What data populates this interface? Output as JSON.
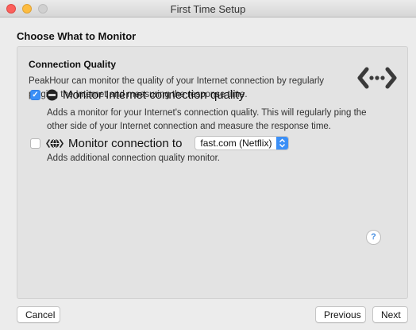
{
  "window": {
    "title": "First Time Setup"
  },
  "heading": "Choose What to Monitor",
  "section": {
    "title": "Connection Quality",
    "description": "PeakHour can monitor the quality of your Internet connection by regularly pinging the Internet and measuring the response time.",
    "icon": "ping-arrows-icon"
  },
  "options": [
    {
      "label": "Monitor Internet connection quality",
      "checked": true,
      "icon": "connection-quality-icon",
      "description": "Adds a monitor for your Internet's connection quality. This will regularly ping the other side of your Internet connection and measure the response time."
    },
    {
      "label": "Monitor connection to",
      "checked": false,
      "icon": "globe-ping-icon",
      "select_value": "fast.com (Netflix)",
      "description": "Adds additional connection quality monitor."
    }
  ],
  "help_label": "?",
  "buttons": {
    "cancel": "Cancel",
    "previous": "Previous",
    "next": "Next"
  },
  "colors": {
    "accent": "#3b8ff6",
    "close": "#fc605c",
    "minimize": "#fdbc40"
  }
}
